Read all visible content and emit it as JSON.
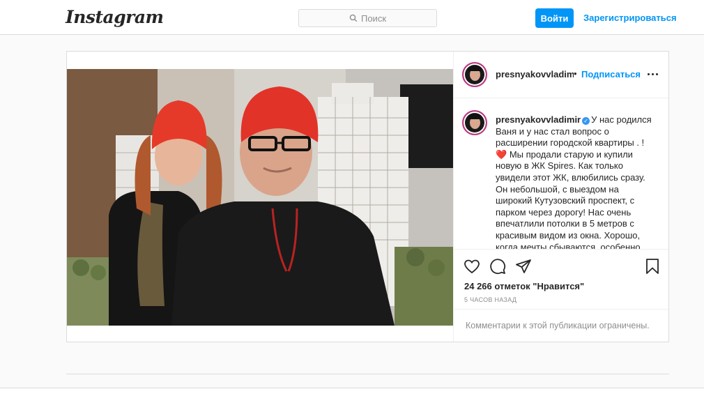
{
  "header": {
    "logo_text": "Instagram",
    "search_placeholder": "Поиск",
    "login_label": "Войти",
    "signup_label": "Зарегистрироваться"
  },
  "post": {
    "username": "presnyakovvladimir",
    "header_dot": "•",
    "follow_label": "Подписаться",
    "caption_text": "У нас родился Ваня и у нас стал вопрос о расширении городской квартиры . !",
    "caption_emoji": "❤️",
    "caption_text_2": "Мы продали старую и купили новую в ЖК Spires. Как только увидели этот ЖК, влюбились сразу. Он небольшой, с выездом на широкий Кутузовский проспект, с парком через дорогу! Нас очень впечатлили потолки в 5 метров с красивым видом из окна. Хорошо, когда мечты сбываются, особенно",
    "likes_text": "24 266 отметок \"Нравится\"",
    "time_text": "5 ЧАСОВ НАЗАД",
    "comments_restricted": "Комментарии к этой публикации ограничены."
  },
  "icons": {
    "search": "search-icon",
    "like": "heart-icon",
    "comment": "comment-icon",
    "share": "share-icon",
    "save": "bookmark-icon",
    "more": "more-options-icon",
    "verified": "verified-badge-icon"
  },
  "colors": {
    "accent": "#0095f6",
    "background": "#fafafa",
    "border": "#dbdbdb",
    "muted_text": "#8e8e8e"
  }
}
